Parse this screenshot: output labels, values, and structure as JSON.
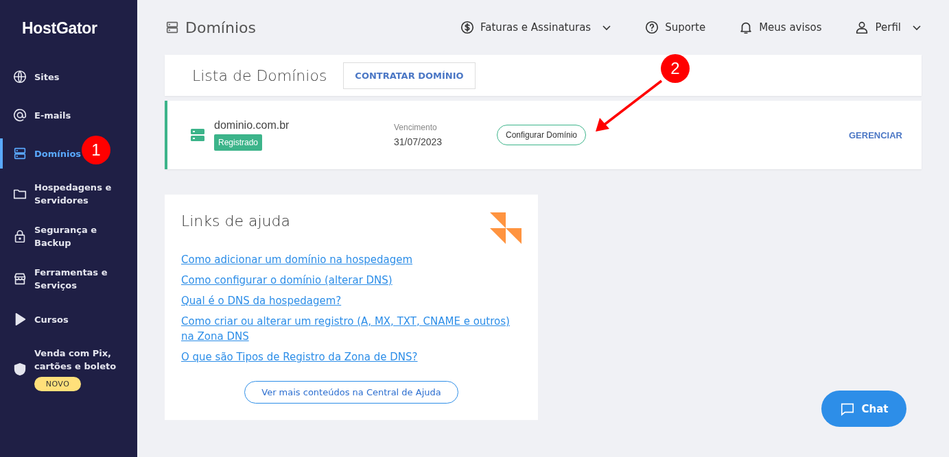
{
  "sidebar": {
    "logo": "HostGator",
    "items": [
      {
        "label": "Sites",
        "selected": false
      },
      {
        "label": "E-mails",
        "selected": false
      },
      {
        "label": "Domínios",
        "selected": true
      },
      {
        "label": "Hospedagens e Servidores",
        "selected": false
      },
      {
        "label": "Segurança e Backup",
        "selected": false
      },
      {
        "label": "Ferramentas e Serviços",
        "selected": false
      },
      {
        "label": "Cursos",
        "selected": false
      },
      {
        "label": "Venda com Pix, cartões e boleto",
        "selected": false,
        "badge": "NOVO"
      }
    ]
  },
  "header": {
    "title": "Domínios",
    "menu": [
      {
        "label": "Faturas e Assinaturas",
        "dropdown": true
      },
      {
        "label": "Suporte",
        "dropdown": false
      },
      {
        "label": "Meus avisos",
        "dropdown": false
      },
      {
        "label": "Perfil",
        "dropdown": true
      }
    ]
  },
  "domains_card": {
    "title": "Lista de Domínios",
    "action": "CONTRATAR DOMÍNIO"
  },
  "domain_row": {
    "name": "dominio.com.br",
    "status": "Registrado",
    "due_label": "Vencimento",
    "due_date": "31/07/2023",
    "configure": "Configurar Domínio",
    "manage": "GERENCIAR"
  },
  "help": {
    "title": "Links de ajuda",
    "links": [
      "Como adicionar um domínio na hospedagem",
      "Como configurar o domínio (alterar DNS)",
      "Qual é o DNS da hospedagem?",
      "Como criar ou alterar um registro (A, MX, TXT, CNAME e outros) na Zona DNS",
      "O que são Tipos de Registro da Zona de DNS?"
    ],
    "more": "Ver mais conteúdos na Central de Ajuda"
  },
  "chat": "Chat",
  "annotations": [
    "1",
    "2"
  ]
}
